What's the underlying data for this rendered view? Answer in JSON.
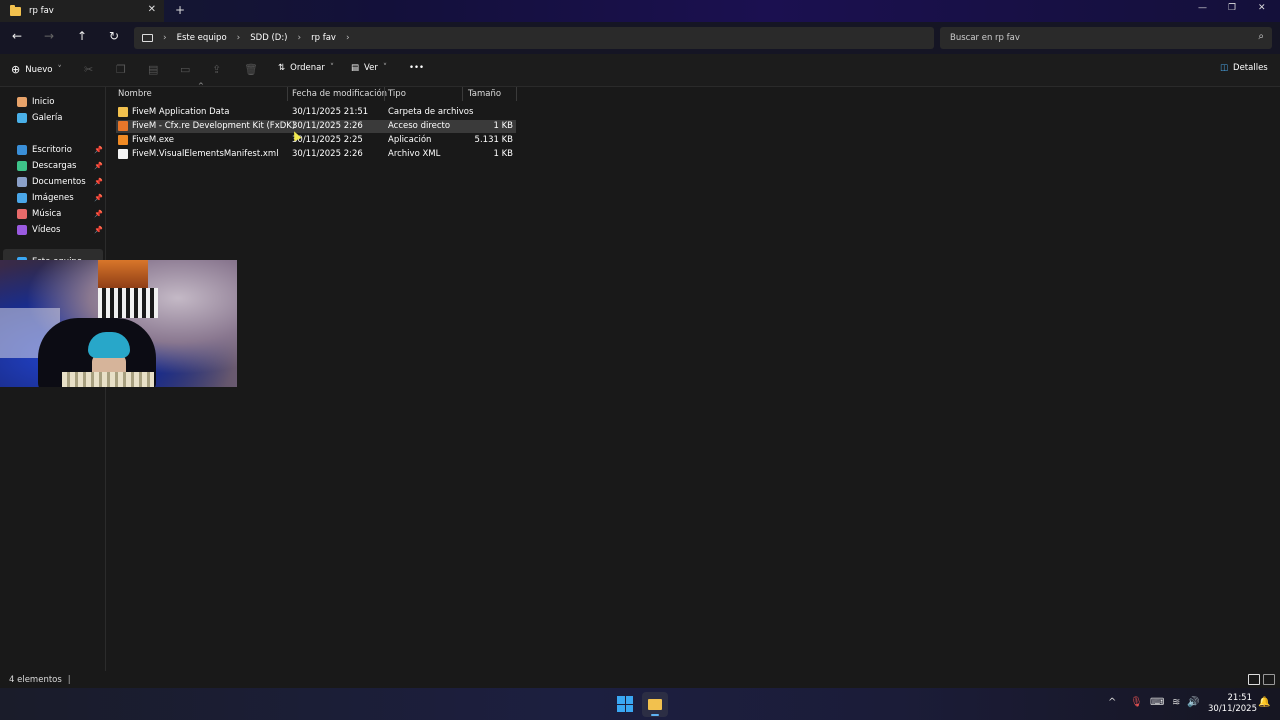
{
  "window": {
    "tab_title": "rp fav",
    "tab_close": "✕",
    "new_tab": "+",
    "minimize": "—",
    "maximize": "❐",
    "close": "✕"
  },
  "nav": {
    "back": "←",
    "forward": "→",
    "up": "↑",
    "refresh": "↻",
    "breadcrumbs": [
      "Este equipo",
      "SDD (D:)",
      "rp fav"
    ],
    "search_placeholder": "Buscar en rp fav"
  },
  "toolbar": {
    "new_label": "Nuevo",
    "sort_label": "Ordenar",
    "view_label": "Ver",
    "more_label": "•••",
    "details_label": "Detalles"
  },
  "sidebar": {
    "items": [
      {
        "label": "Inicio",
        "icon": "home-icon",
        "color": "#e8a36a",
        "pinned": false
      },
      {
        "label": "Galería",
        "icon": "gallery-icon",
        "color": "#4ab0e8",
        "pinned": false
      },
      {
        "label": "Escritorio",
        "icon": "desktop-icon",
        "color": "#3a8fd8",
        "pinned": true
      },
      {
        "label": "Descargas",
        "icon": "downloads-icon",
        "color": "#3ec48a",
        "pinned": true
      },
      {
        "label": "Documentos",
        "icon": "documents-icon",
        "color": "#8aa0c8",
        "pinned": true
      },
      {
        "label": "Imágenes",
        "icon": "pictures-icon",
        "color": "#4aa6e8",
        "pinned": true
      },
      {
        "label": "Música",
        "icon": "music-icon",
        "color": "#e86a6a",
        "pinned": true
      },
      {
        "label": "Vídeos",
        "icon": "videos-icon",
        "color": "#9a5ae0",
        "pinned": true
      },
      {
        "label": "Este equipo",
        "icon": "computer-icon",
        "color": "#3aa7f3",
        "pinned": false
      }
    ]
  },
  "files": {
    "columns": [
      "Nombre",
      "Fecha de modificación",
      "Tipo",
      "Tamaño"
    ],
    "rows": [
      {
        "name": "FiveM Application Data",
        "date": "30/11/2025 21:51",
        "type": "Carpeta de archivos",
        "size": "",
        "icon": "folder-icon",
        "color": "#f2c14e"
      },
      {
        "name": "FiveM - Cfx.re Development Kit (FxDK)",
        "date": "30/11/2025 2:26",
        "type": "Acceso directo",
        "size": "1 KB",
        "icon": "shortcut-icon",
        "color": "#e8762a"
      },
      {
        "name": "FiveM.exe",
        "date": "30/11/2025 2:25",
        "type": "Aplicación",
        "size": "5.131 KB",
        "icon": "fivem-app-icon",
        "color": "#f08a24"
      },
      {
        "name": "FiveM.VisualElementsManifest.xml",
        "date": "30/11/2025 2:26",
        "type": "Archivo XML",
        "size": "1 KB",
        "icon": "xml-file-icon",
        "color": "#f4f4f4"
      }
    ]
  },
  "status": {
    "count": "4 elementos"
  },
  "taskbar": {
    "time": "21:51",
    "date": "30/11/2025",
    "chevron": "^",
    "mic": "🎙",
    "keyboard": "⌨",
    "wifi": "≋",
    "volume": "🔊",
    "notifications": "🔔"
  }
}
